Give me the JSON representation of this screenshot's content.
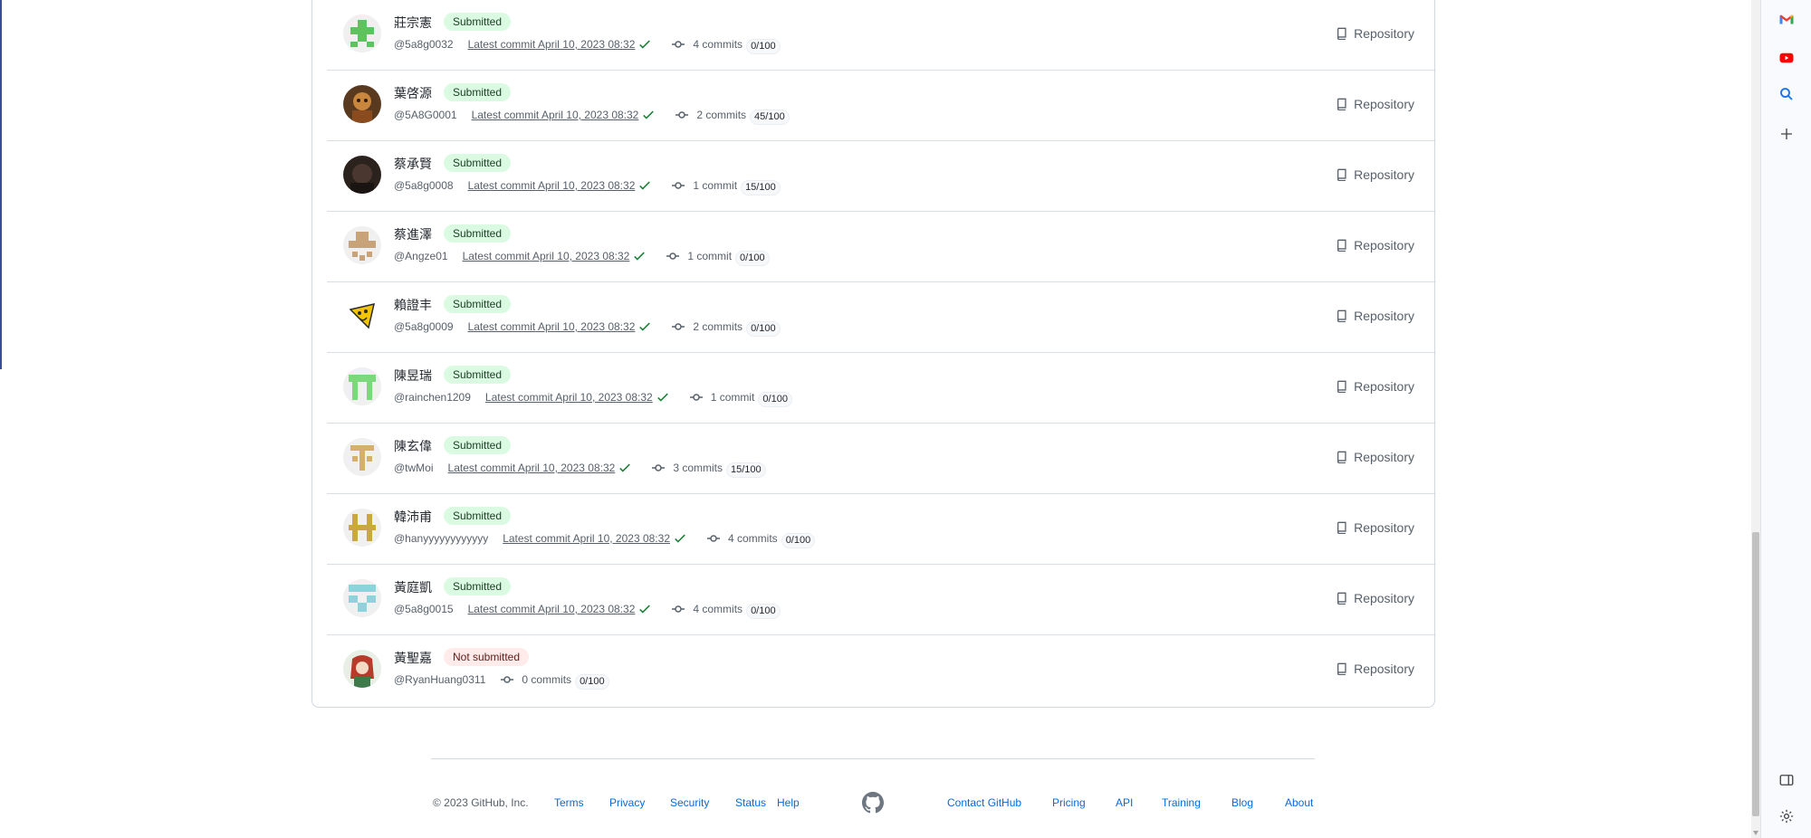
{
  "repo_label": "Repository",
  "latest_commit_prefix": "Latest commit",
  "students": [
    {
      "name": "莊宗憲",
      "status": "Submitted",
      "handle": "@5a8g0032",
      "commit_date": "April 10, 2023 08:32",
      "commits": "4 commits",
      "score": "0/100"
    },
    {
      "name": "葉啓源",
      "status": "Submitted",
      "handle": "@5A8G0001",
      "commit_date": "April 10, 2023 08:32",
      "commits": "2 commits",
      "score": "45/100"
    },
    {
      "name": "蔡承賢",
      "status": "Submitted",
      "handle": "@5a8g0008",
      "commit_date": "April 10, 2023 08:32",
      "commits": "1 commit",
      "score": "15/100"
    },
    {
      "name": "蔡進澤",
      "status": "Submitted",
      "handle": "@Angze01",
      "commit_date": "April 10, 2023 08:32",
      "commits": "1 commit",
      "score": "0/100"
    },
    {
      "name": "賴證丰",
      "status": "Submitted",
      "handle": "@5a8g0009",
      "commit_date": "April 10, 2023 08:32",
      "commits": "2 commits",
      "score": "0/100"
    },
    {
      "name": "陳昱瑞",
      "status": "Submitted",
      "handle": "@rainchen1209",
      "commit_date": "April 10, 2023 08:32",
      "commits": "1 commit",
      "score": "0/100"
    },
    {
      "name": "陳玄偉",
      "status": "Submitted",
      "handle": "@twMoi",
      "commit_date": "April 10, 2023 08:32",
      "commits": "3 commits",
      "score": "15/100"
    },
    {
      "name": "韓沛甫",
      "status": "Submitted",
      "handle": "@hanyyyyyyyyyyyy",
      "commit_date": "April 10, 2023 08:32",
      "commits": "4 commits",
      "score": "0/100"
    },
    {
      "name": "黃庭凱",
      "status": "Submitted",
      "handle": "@5a8g0015",
      "commit_date": "April 10, 2023 08:32",
      "commits": "4 commits",
      "score": "0/100"
    },
    {
      "name": "黃聖嘉",
      "status": "Not submitted",
      "handle": "@RyanHuang0311",
      "commit_date": "",
      "commits": "0 commits",
      "score": "0/100"
    }
  ],
  "footer": {
    "copyright": "© 2023 GitHub, Inc.",
    "links_left": [
      "Terms",
      "Privacy",
      "Security",
      "Status",
      "Help"
    ],
    "links_right": [
      "Contact GitHub",
      "Pricing",
      "API",
      "Training",
      "Blog",
      "About"
    ]
  },
  "colors": {
    "submitted_bg": "#dafbe1",
    "not_submitted_bg": "#ffebe9",
    "link": "#0969da",
    "check": "#1a7f37"
  },
  "icons": {
    "sidebar": [
      "gmail-icon",
      "youtube-icon",
      "search-icon",
      "add-icon",
      "side-panel-icon",
      "settings-icon"
    ]
  }
}
